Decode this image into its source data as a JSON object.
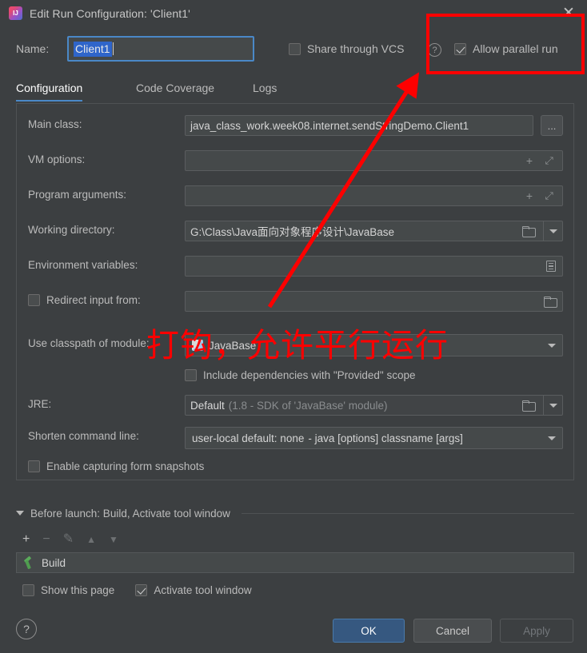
{
  "window": {
    "title": "Edit Run Configuration: 'Client1'",
    "app_icon": "intellij-idea-logo",
    "close_label": "✕"
  },
  "name_row": {
    "label": "Name:",
    "value": "Client1",
    "share_vcs": {
      "label": "Share through VCS",
      "checked": false
    },
    "help_glyph": "?",
    "allow_parallel": {
      "label": "Allow parallel run",
      "checked": true
    }
  },
  "tabs": [
    {
      "label": "Configuration",
      "active": true
    },
    {
      "label": "Code Coverage",
      "active": false
    },
    {
      "label": "Logs",
      "active": false
    }
  ],
  "form": {
    "main_class": {
      "label": "Main class:",
      "value": "java_class_work.week08.internet.sendStringDemo.Client1",
      "browse_label": "..."
    },
    "vm_options": {
      "label": "VM options:",
      "value": "",
      "add_glyph": "+",
      "expand_glyph": "⤡"
    },
    "program_arguments": {
      "label": "Program arguments:",
      "value": "",
      "add_glyph": "+",
      "expand_glyph": "⤡"
    },
    "working_directory": {
      "label": "Working directory:",
      "value": "G:\\Class\\Java面向对象程序设计\\JavaBase"
    },
    "environment_variables": {
      "label": "Environment variables:",
      "value": ""
    },
    "redirect_input": {
      "label": "Redirect input from:",
      "checked": false,
      "value": ""
    },
    "use_classpath": {
      "label": "Use classpath of module:",
      "value": "JavaBase"
    },
    "include_provided": {
      "label": "Include dependencies with \"Provided\" scope",
      "checked": false
    },
    "jre": {
      "label": "JRE:",
      "value_strong": "Default",
      "value_muted": "(1.8 - SDK of 'JavaBase' module)"
    },
    "shorten_command_line": {
      "label": "Shorten command line:",
      "value_strong": "user-local default: none",
      "value_muted": "- java [options] classname [args]"
    },
    "enable_snapshots": {
      "label": "Enable capturing form snapshots",
      "checked": false
    }
  },
  "before_launch": {
    "title": "Before launch: Build, Activate tool window",
    "toolbar": {
      "add": "+",
      "remove": "−",
      "edit": "✎",
      "move_up": "▲",
      "move_down": "▼"
    },
    "items": [
      {
        "label": "Build",
        "icon": "hammer-icon"
      }
    ],
    "show_this_page": {
      "label": "Show this page",
      "checked": false
    },
    "activate_tool_window": {
      "label": "Activate tool window",
      "checked": true
    }
  },
  "buttons": {
    "help_glyph": "?",
    "ok": "OK",
    "cancel": "Cancel",
    "apply": "Apply"
  },
  "annotations": {
    "highlight_box_target": "Allow parallel run",
    "note_text": "打钩，允许平行运行",
    "color": "#fe0000"
  }
}
